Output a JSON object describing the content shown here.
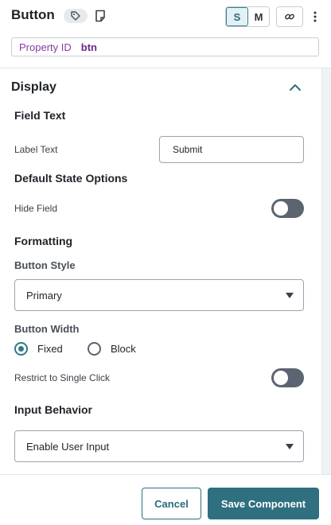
{
  "header": {
    "title": "Button",
    "tag_icon": "tag-icon",
    "doc_icon": "document-icon",
    "size_options": [
      {
        "label": "S",
        "active": true
      },
      {
        "label": "M",
        "active": false
      }
    ],
    "link_icon": "link-icon",
    "more_icon": "more-vertical-icon"
  },
  "property": {
    "label": "Property ID",
    "value": "btn"
  },
  "display": {
    "title": "Display",
    "chevron_icon": "chevron-up-icon",
    "field_text_heading": "Field Text",
    "label_text_label": "Label Text",
    "label_text_value": "Submit",
    "default_state_heading": "Default State Options",
    "hide_field_label": "Hide Field",
    "hide_field_on": false,
    "formatting_heading": "Formatting",
    "button_style_label": "Button Style",
    "button_style_value": "Primary",
    "button_width_label": "Button Width",
    "width_options": [
      {
        "label": "Fixed",
        "selected": true
      },
      {
        "label": "Block",
        "selected": false
      }
    ],
    "restrict_label": "Restrict to Single Click",
    "restrict_on": false,
    "input_behavior_heading": "Input Behavior",
    "input_behavior_value": "Enable User Input"
  },
  "footer": {
    "cancel_label": "Cancel",
    "save_label": "Save Component"
  },
  "colors": {
    "accent": "#2f6f80",
    "property_label": "#8a3aa6",
    "toggle_off": "#5b6470"
  }
}
